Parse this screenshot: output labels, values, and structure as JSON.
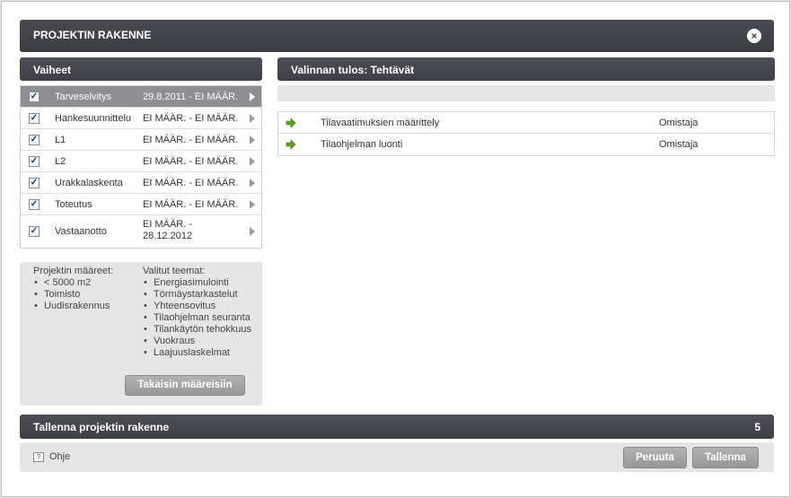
{
  "dialog": {
    "title": "PROJEKTIN RAKENNE",
    "close_label": "×"
  },
  "phases": {
    "header": "Vaiheet",
    "items": [
      {
        "name": "Tarveselvitys",
        "dates": "29.8.2011 - EI MÄÄR.",
        "checked": true,
        "active": true
      },
      {
        "name": "Hankesuunnittelu",
        "dates": "EI MÄÄR. - EI MÄÄR.",
        "checked": true
      },
      {
        "name": "L1",
        "dates": "EI MÄÄR. - EI MÄÄR.",
        "checked": true
      },
      {
        "name": "L2",
        "dates": "EI MÄÄR. - EI MÄÄR.",
        "checked": true
      },
      {
        "name": "Urakkalaskenta",
        "dates": "EI MÄÄR. - EI MÄÄR.",
        "checked": true
      },
      {
        "name": "Toteutus",
        "dates": "EI MÄÄR. - EI MÄÄR.",
        "checked": true
      },
      {
        "name": "Vastaanotto",
        "dates": "EI MÄÄR. - 28.12.2012",
        "checked": true
      }
    ]
  },
  "definitions": {
    "project_title": "Projektin määreet:",
    "project_items": [
      "< 5000 m2",
      "Toimisto",
      "Uudisrakennus"
    ],
    "themes_title": "Valitut teemat:",
    "theme_items": [
      "Energiasimulointi",
      "Törmäystarkastelut",
      "Yhteensovitus",
      "Tilaohjelman seuranta",
      "Tilankäytön tehokkuus",
      "Vuokraus",
      "Laajuuslaskelmat"
    ],
    "back_button": "Takaisin määreisiin"
  },
  "result": {
    "header": "Valinnan tulos: Tehtävät",
    "tasks": [
      {
        "name": "Tilavaatimuksien määrittely",
        "owner": "Omistaja"
      },
      {
        "name": "Tilaohjelman luonti",
        "owner": "Omistaja"
      }
    ]
  },
  "save_bar": {
    "label": "Tallenna projektin rakenne",
    "count": "5"
  },
  "footer": {
    "help_label": "Ohje",
    "cancel_button": "Peruuta",
    "save_button": "Tallenna"
  },
  "colors": {
    "header_bg": "#3f4047",
    "active_row": "#8e8e93",
    "task_arrow": "#5aa21c",
    "button_bg": "#a3a3a3"
  }
}
